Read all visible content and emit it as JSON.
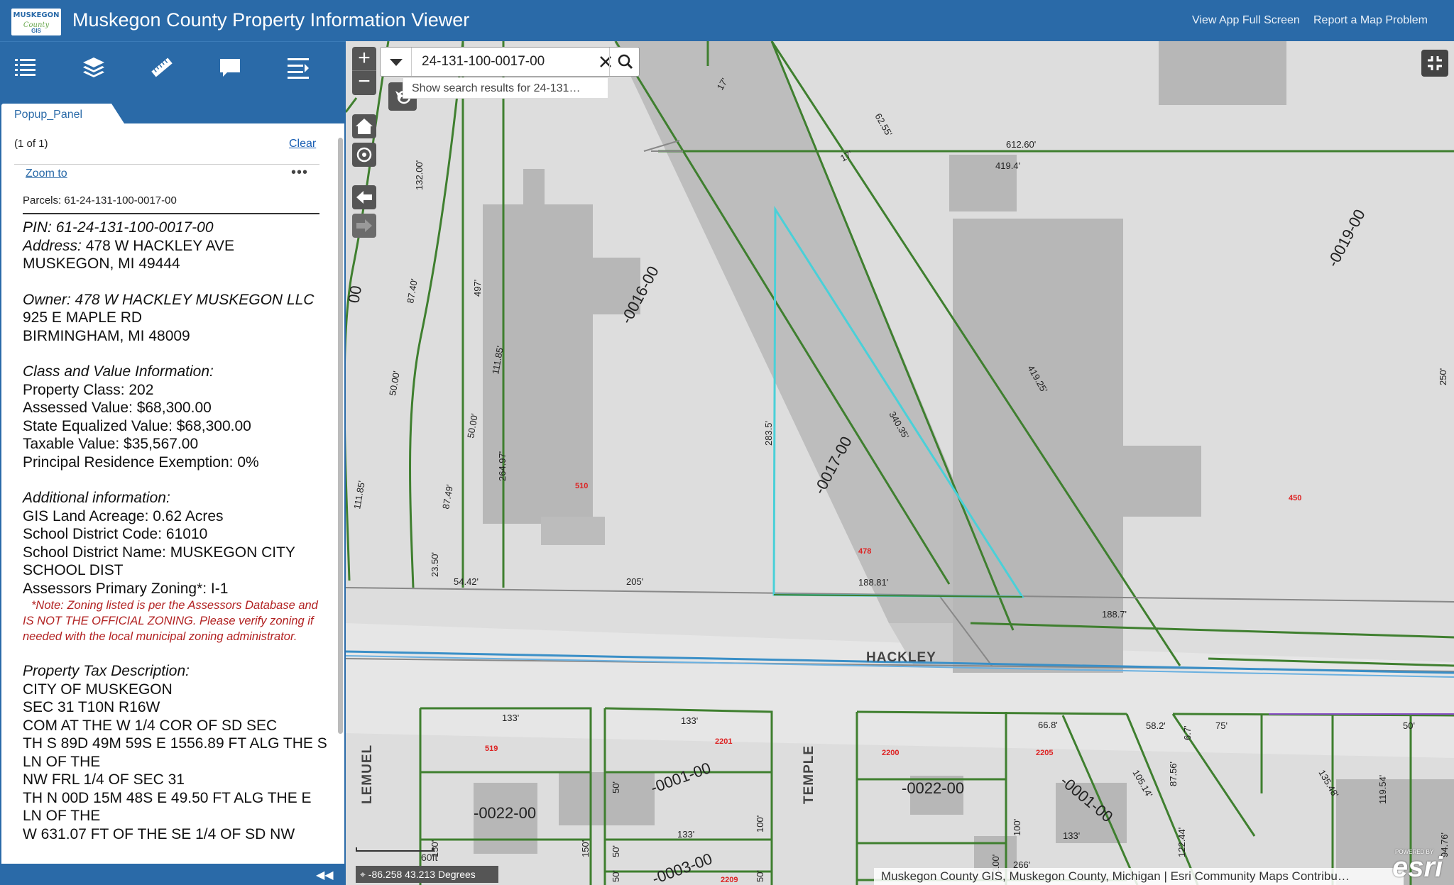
{
  "header": {
    "logo_line1": "MUSKEGON",
    "logo_line2": "County",
    "logo_line3": "GIS",
    "title": "Muskegon County Property Information Viewer",
    "link_fullscreen": "View App Full Screen",
    "link_report": "Report a Map Problem"
  },
  "toolbar": {
    "icons": [
      "legend-list-icon",
      "layers-icon",
      "measure-ruler-icon",
      "comment-icon",
      "menu-list-icon"
    ]
  },
  "panel": {
    "tab_label": "Popup_Panel",
    "count": "(1 of 1)",
    "clear": "Clear",
    "zoom_to": "Zoom to",
    "more": "•••",
    "parcel_header": "Parcels: 61-24-131-100-0017-00",
    "pin_label": "PIN:",
    "pin": "61-24-131-100-0017-00",
    "address_label": "Address:",
    "address_line1": "478 W HACKLEY AVE",
    "address_line2": "MUSKEGON, MI  49444",
    "owner_label": "Owner:",
    "owner_name": "478 W HACKLEY MUSKEGON LLC",
    "owner_line2": "925 E MAPLE RD",
    "owner_line3": "BIRMINGHAM, MI  48009",
    "class_header": "Class and Value Information:",
    "property_class": "Property Class: 202",
    "assessed_value": "Assessed Value: $68,300.00",
    "sev": "State Equalized Value: $68,300.00",
    "taxable_value": "Taxable Value: $35,567.00",
    "pre": "Principal Residence Exemption: 0%",
    "additional_header": "Additional information:",
    "acreage": "GIS Land Acreage: 0.62 Acres",
    "school_code": "School District Code: 61010",
    "school_name": "School District Name: MUSKEGON CITY SCHOOL DIST",
    "zoning": "Assessors Primary Zoning*: I-1",
    "zoning_note": "*Note: Zoning listed is per the Assessors Database and IS NOT THE OFFICIAL ZONING.   Please verify zoning if needed with the local municipal zoning administrator.",
    "tax_desc_header": "Property Tax Description:",
    "tax_desc_lines": [
      "CITY OF MUSKEGON",
      "SEC 31 T10N R16W",
      "COM AT THE W 1/4 COR OF SD SEC",
      "TH S 89D 49M 59S E 1556.89 FT ALG THE S LN OF THE",
      "NW FRL 1/4 OF SEC 31",
      "TH N 00D 15M 48S E 49.50 FT ALG THE E LN OF THE",
      "W 631.07 FT OF THE SE 1/4 OF SD NW"
    ]
  },
  "map": {
    "search_value": "24-131-100-0017-00",
    "search_suggestion": "Show search results for 24-131…",
    "coords": "-86.258 43.213 Degrees",
    "scale_label": "60ft",
    "attribution": "Muskegon County GIS, Muskegon County, Michigan | Esri Community Maps Contribu…",
    "esri_powered": "POWERED BY",
    "esri_logo": "esri",
    "street_hackley": "HACKLEY",
    "street_lemuel": "LEMUEL",
    "street_temple": "TEMPLE",
    "parcel_labels": {
      "p0016": "-0016-00",
      "p0017": "-0017-00",
      "p0019": "-0019-00",
      "p0022a": "-0022-00",
      "p0001a": "-0001-00",
      "p0022b": "-0022-00",
      "p0001b": "-0001-00",
      "p0003": "-0003-00",
      "p00_left": "00"
    },
    "address_numbers": {
      "a510": "510",
      "a478": "478",
      "a450": "450",
      "a519": "519",
      "a2201": "2201",
      "a2200": "2200",
      "a2205": "2205",
      "a2209": "2209"
    },
    "dims": {
      "d17a": "17'",
      "d17b": "17'",
      "d6255": "62.55'",
      "d61260": "612.60'",
      "d4194": "419.4'",
      "d13200": "132.00'",
      "d8740": "87.40'",
      "d5000a": "50.00'",
      "d497": "497'",
      "d11185a": "111.85'",
      "d5000b": "50.00'",
      "d26497": "264.97'",
      "d8749": "87.49'",
      "d2350": "23.50'",
      "d5442": "54.42'",
      "d205": "205'",
      "d18881": "188.81'",
      "d2835": "283.5'",
      "d34035": "340.35'",
      "d41925": "419.25'",
      "d1887": "188.7'",
      "d11185b": "111.85'",
      "d133a": "133'",
      "d133b": "133'",
      "d133c": "133'",
      "d133d": "133'",
      "d50a": "50'",
      "d50b": "50'",
      "d50c": "50'",
      "d50d": "50'",
      "d150a": "150'",
      "d150b": "150'",
      "d100a": "100'",
      "d100b": "100'",
      "d100c": "100'",
      "d668": "66.8'",
      "d582": "58.2'",
      "d75": "75'",
      "d50e": "50'",
      "d67": "6.7'",
      "d10514": "105.14'",
      "d8756": "87.56'",
      "d13548": "135.48'",
      "d11954": "119.54'",
      "d266": "266'",
      "d12244": "122.44'",
      "d9476": "94.76'",
      "d250": "250'"
    }
  }
}
